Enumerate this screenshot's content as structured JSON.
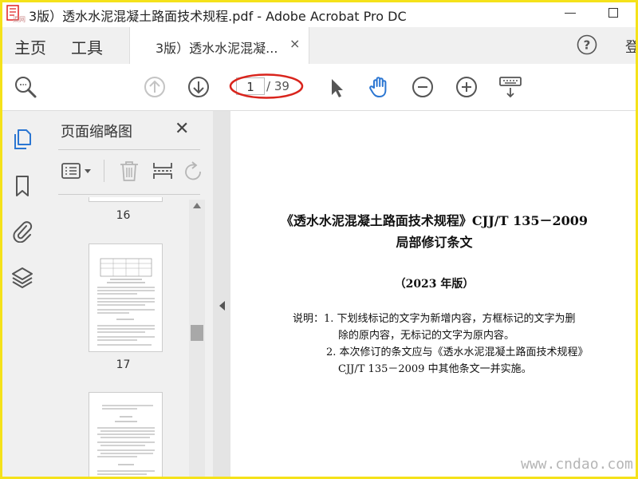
{
  "window": {
    "title": "3版）透水水泥混凝土路面技术规程.pdf - Adobe Acrobat Pro DC",
    "logo_text": "渠网",
    "minimize_icon": "minimize-icon",
    "maximize_icon": "maximize-icon"
  },
  "tabs": {
    "home": "主页",
    "tools": "工具",
    "document": "3版）透水水泥混凝...",
    "close": "×",
    "signin_partial": "登"
  },
  "toolbar": {
    "current_page": "1",
    "total_pages": "/ 39",
    "highlight_color": "#d9241c",
    "icons": [
      "search-icon",
      "page-up-icon",
      "page-down-icon",
      "select-arrow-icon",
      "hand-tool-icon",
      "zoom-out-icon",
      "zoom-in-icon",
      "keyboard-scroll-icon"
    ]
  },
  "left_rail": {
    "icons": [
      "page-thumbnails-icon",
      "bookmark-icon",
      "attachment-icon",
      "layers-icon"
    ],
    "accent_color": "#2b76d2"
  },
  "thumbnails_panel": {
    "title": "页面缩略图",
    "close": "✕",
    "pages": [
      {
        "label": "16"
      },
      {
        "label": "17"
      }
    ]
  },
  "document": {
    "title_line1": "《透水水泥混凝土路面技术规程》CJJ/T 135－2009",
    "title_line2": "局部修订条文",
    "edition": "（2023 年版）",
    "notes": [
      "说明：1. 下划线标记的文字为新增内容，方框标记的文字为删",
      "除的原内容，无标记的文字为原内容。",
      "2. 本次修订的条文应与《透水水泥混凝土路面技术规程》",
      "CJJ/T 135－2009 中其他条文一并实施。"
    ]
  },
  "watermark": "www.cndao.com"
}
